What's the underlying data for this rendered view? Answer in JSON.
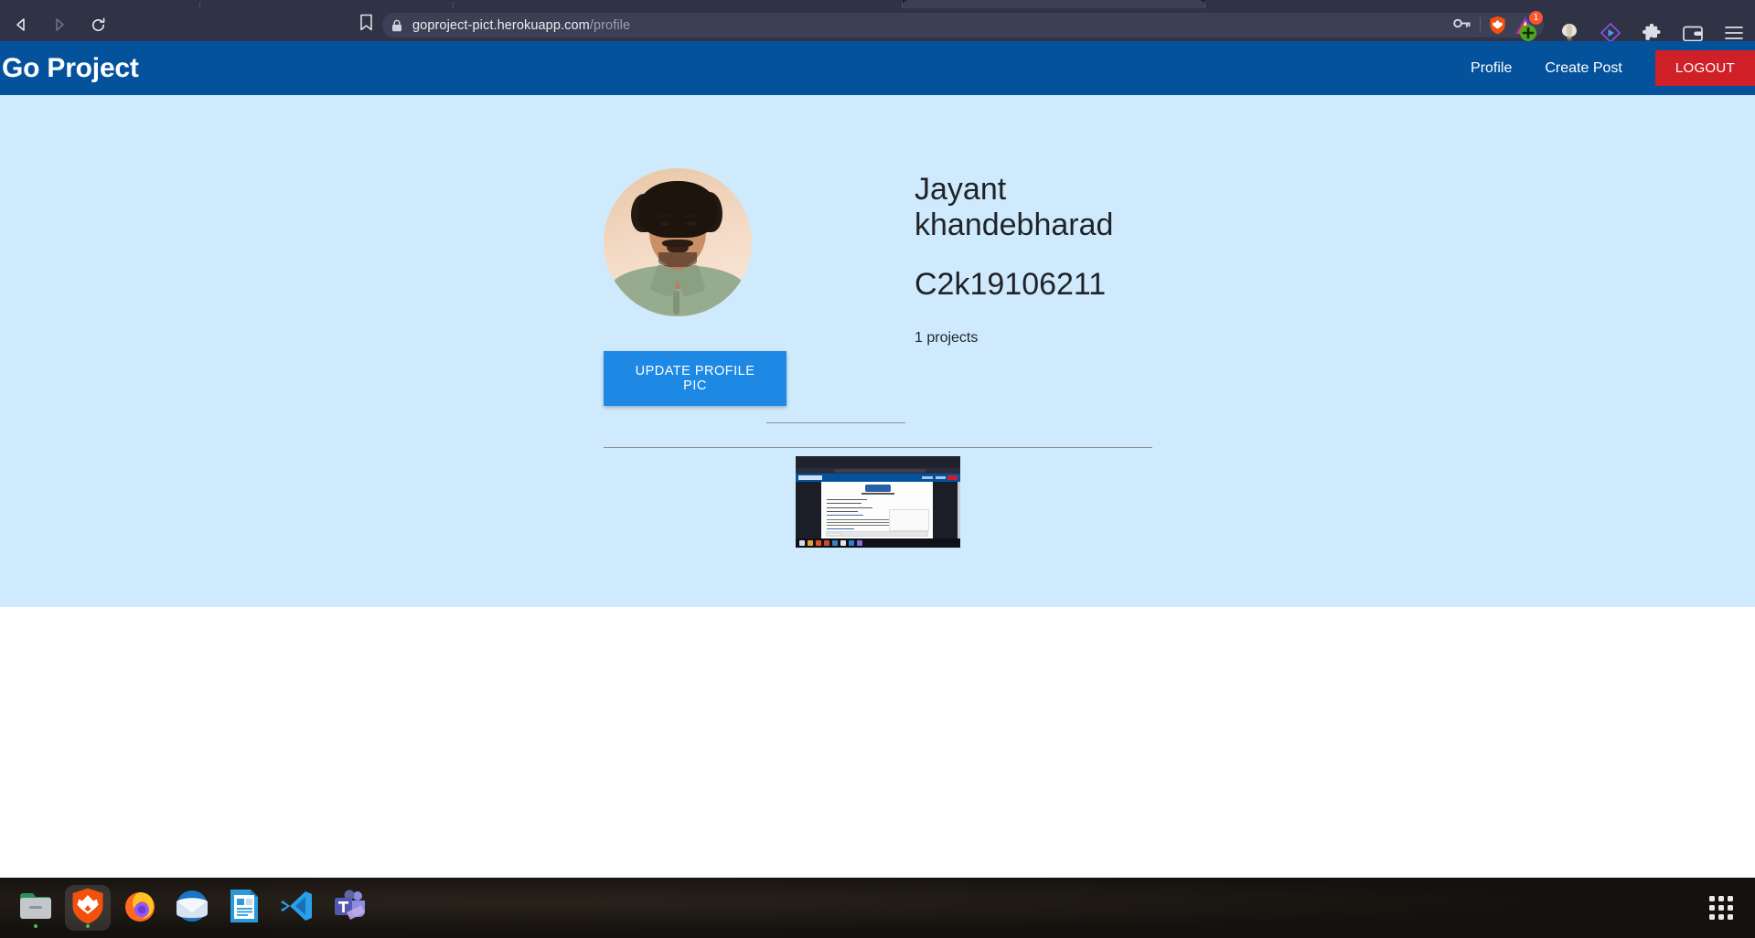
{
  "browser": {
    "back_icon": "back-arrow-icon",
    "forward_icon": "forward-arrow-icon",
    "reload_icon": "reload-icon",
    "bookmark_icon": "bookmark-icon",
    "lock_icon": "lock-icon",
    "url_host": "goproject-pict.herokuapp.com",
    "url_path": "/profile",
    "url_full": "goproject-pict.herokuapp.com/profile",
    "password_key_icon": "key-icon",
    "brave_shield_icon": "brave-lion-shield-icon",
    "rewards_icon": "brave-rewards-triangle-icon",
    "rewards_badge": "1",
    "extension_icons": [
      "green-plus-icon",
      "balloon-icon",
      "brave-player-icon",
      "puzzle-extensions-icon",
      "wallet-icon",
      "hamburger-menu-icon"
    ]
  },
  "app": {
    "brand": "Go Project",
    "nav": [
      {
        "label": "Profile"
      },
      {
        "label": "Create Post"
      }
    ],
    "logout_label": "LOGOUT",
    "header_color": "#04529c",
    "logout_color": "#cf2028",
    "content_bg": "#cfeafd"
  },
  "profile": {
    "avatar_alt": "profile-photo",
    "update_button": "UPDATE PROFILE PIC",
    "update_button_color": "#1e88e5",
    "name": "Jayant khandebharad",
    "user_id": "C2k19106211",
    "project_count": "1 projects"
  },
  "posts": [
    {
      "thumbnail_alt": "post-screenshot-thumbnail"
    }
  ],
  "taskbar": {
    "items": [
      {
        "name": "files-icon",
        "active": false
      },
      {
        "name": "brave-browser-icon",
        "active": true
      },
      {
        "name": "firefox-icon",
        "active": false
      },
      {
        "name": "thunderbird-icon",
        "active": false
      },
      {
        "name": "libreoffice-writer-icon",
        "active": false
      },
      {
        "name": "vscode-icon",
        "active": false
      },
      {
        "name": "microsoft-teams-icon",
        "active": false
      }
    ],
    "show_apps_icon": "show-applications-grid-icon"
  }
}
